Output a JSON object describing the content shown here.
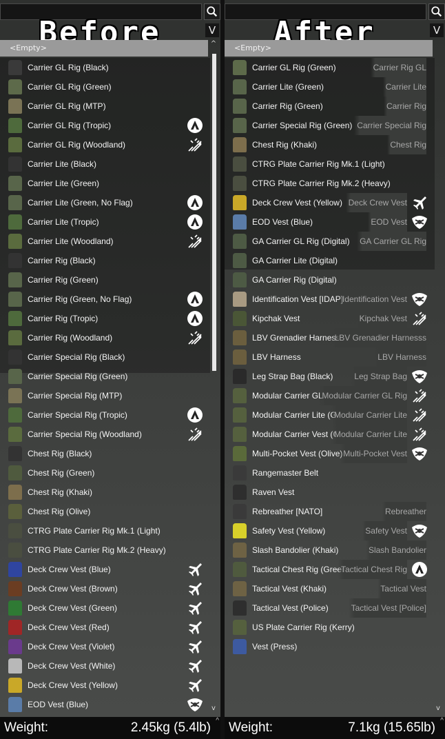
{
  "left": {
    "banner": "Before",
    "search": {
      "value": "",
      "placeholder": ""
    },
    "sort_label": "V",
    "empty_label": "<Empty>",
    "weight_label": "Weight:",
    "weight_value": "2.45kg (5.4lb)",
    "items": [
      {
        "name": "Carrier GL Rig (Black)",
        "source": "",
        "icon": "",
        "color": "#3a3a3a"
      },
      {
        "name": "Carrier GL Rig (Green)",
        "source": "",
        "icon": "",
        "color": "#5d6a4a"
      },
      {
        "name": "Carrier GL Rig (MTP)",
        "source": "",
        "icon": "",
        "color": "#7a7355"
      },
      {
        "name": "Carrier GL Rig (Tropic)",
        "source": "",
        "icon": "apex-icon",
        "color": "#4e6a3c"
      },
      {
        "name": "Carrier GL Rig (Woodland)",
        "source": "",
        "icon": "contact-icon",
        "color": "#5a6b3e"
      },
      {
        "name": "Carrier Lite (Black)",
        "source": "",
        "icon": "",
        "color": "#333"
      },
      {
        "name": "Carrier Lite (Green)",
        "source": "",
        "icon": "",
        "color": "#58654a"
      },
      {
        "name": "Carrier Lite (Green, No Flag)",
        "source": "",
        "icon": "apex-icon",
        "color": "#58654a"
      },
      {
        "name": "Carrier Lite (Tropic)",
        "source": "",
        "icon": "apex-icon",
        "color": "#4e6a3c"
      },
      {
        "name": "Carrier Lite (Woodland)",
        "source": "",
        "icon": "contact-icon",
        "color": "#5a6b3e"
      },
      {
        "name": "Carrier Rig (Black)",
        "source": "",
        "icon": "",
        "color": "#333"
      },
      {
        "name": "Carrier Rig (Green)",
        "source": "",
        "icon": "",
        "color": "#58654a"
      },
      {
        "name": "Carrier Rig (Green, No Flag)",
        "source": "",
        "icon": "apex-icon",
        "color": "#58654a"
      },
      {
        "name": "Carrier Rig (Tropic)",
        "source": "",
        "icon": "apex-icon",
        "color": "#4e6a3c"
      },
      {
        "name": "Carrier Rig (Woodland)",
        "source": "",
        "icon": "contact-icon",
        "color": "#5a6b3e"
      },
      {
        "name": "Carrier Special Rig (Black)",
        "source": "",
        "icon": "",
        "color": "#333"
      },
      {
        "name": "Carrier Special Rig (Green)",
        "source": "",
        "icon": "",
        "color": "#58654a"
      },
      {
        "name": "Carrier Special Rig (MTP)",
        "source": "",
        "icon": "",
        "color": "#7a7355"
      },
      {
        "name": "Carrier Special Rig (Tropic)",
        "source": "",
        "icon": "apex-icon",
        "color": "#4e6a3c"
      },
      {
        "name": "Carrier Special Rig (Woodland)",
        "source": "",
        "icon": "contact-icon",
        "color": "#5a6b3e"
      },
      {
        "name": "Chest Rig (Black)",
        "source": "",
        "icon": "",
        "color": "#333"
      },
      {
        "name": "Chest Rig (Green)",
        "source": "",
        "icon": "",
        "color": "#4f5a3e"
      },
      {
        "name": "Chest Rig (Khaki)",
        "source": "",
        "icon": "",
        "color": "#7d6e4c"
      },
      {
        "name": "Chest Rig (Olive)",
        "source": "",
        "icon": "",
        "color": "#5a5f3c"
      },
      {
        "name": "CTRG Plate Carrier Rig Mk.1 (Light)",
        "source": "",
        "icon": "",
        "color": "#4a4e40"
      },
      {
        "name": "CTRG Plate Carrier Rig Mk.2 (Heavy)",
        "source": "",
        "icon": "",
        "color": "#4a4e40"
      },
      {
        "name": "Deck Crew Vest (Blue)",
        "source": "",
        "icon": "jets-icon",
        "color": "#2f45a0"
      },
      {
        "name": "Deck Crew Vest (Brown)",
        "source": "",
        "icon": "jets-icon",
        "color": "#6b3d22"
      },
      {
        "name": "Deck Crew Vest (Green)",
        "source": "",
        "icon": "jets-icon",
        "color": "#2f7a34"
      },
      {
        "name": "Deck Crew Vest (Red)",
        "source": "",
        "icon": "jets-icon",
        "color": "#a02626"
      },
      {
        "name": "Deck Crew Vest (Violet)",
        "source": "",
        "icon": "jets-icon",
        "color": "#6a3a8c"
      },
      {
        "name": "Deck Crew Vest (White)",
        "source": "",
        "icon": "jets-icon",
        "color": "#b8b8b8"
      },
      {
        "name": "Deck Crew Vest (Yellow)",
        "source": "",
        "icon": "jets-icon",
        "color": "#c9a828"
      },
      {
        "name": "EOD Vest (Blue)",
        "source": "",
        "icon": "laws-of-war-icon",
        "color": "#5a7ca8"
      }
    ]
  },
  "right": {
    "banner": "After",
    "search": {
      "value": "",
      "placeholder": ""
    },
    "sort_label": "V",
    "empty_label": "<Empty>",
    "weight_label": "Weight:",
    "weight_value": "7.1kg (15.65lb)",
    "items": [
      {
        "name": "Carrier GL Rig (Green)",
        "source": "Carrier Rig GL",
        "icon": "",
        "color": "#5d6a4a"
      },
      {
        "name": "Carrier Lite (Green)",
        "source": "Carrier Lite",
        "icon": "",
        "color": "#58654a"
      },
      {
        "name": "Carrier Rig (Green)",
        "source": "Carrier Rig",
        "icon": "",
        "color": "#58654a"
      },
      {
        "name": "Carrier Special Rig (Green)",
        "source": "Carrier Special Rig",
        "icon": "",
        "color": "#58654a"
      },
      {
        "name": "Chest Rig (Khaki)",
        "source": "Chest Rig",
        "icon": "",
        "color": "#7d6e4c"
      },
      {
        "name": "CTRG Plate Carrier Rig Mk.1 (Light)",
        "source": "",
        "icon": "",
        "color": "#4a4e40"
      },
      {
        "name": "CTRG Plate Carrier Rig Mk.2 (Heavy)",
        "source": "",
        "icon": "",
        "color": "#4a4e40"
      },
      {
        "name": "Deck Crew Vest (Yellow)",
        "source": "Deck Crew Vest",
        "icon": "jets-icon",
        "color": "#c9a828"
      },
      {
        "name": "EOD Vest (Blue)",
        "source": "EOD Vest",
        "icon": "laws-of-war-icon",
        "color": "#5a7ca8"
      },
      {
        "name": "GA Carrier GL Rig (Digital)",
        "source": "GA Carrier GL Rig",
        "icon": "",
        "color": "#4d5a44"
      },
      {
        "name": "GA Carrier Lite (Digital)",
        "source": "",
        "icon": "",
        "color": "#4d5a44"
      },
      {
        "name": "GA Carrier Rig (Digital)",
        "source": "",
        "icon": "",
        "color": "#4d5a44"
      },
      {
        "name": "Identification Vest [IDAP]",
        "source": "Identification Vest",
        "icon": "laws-of-war-icon",
        "color": "#a89a82"
      },
      {
        "name": "Kipchak Vest",
        "source": "Kipchak Vest",
        "icon": "contact-icon",
        "color": "#4a5636"
      },
      {
        "name": "LBV Grenadier Harness",
        "source": "LBV Grenadier Harnesss",
        "icon": "",
        "color": "#6b5e3e"
      },
      {
        "name": "LBV Harness",
        "source": "LBV Harness",
        "icon": "",
        "color": "#6b5e3e"
      },
      {
        "name": "Leg Strap Bag (Black)",
        "source": "Leg Strap Bag",
        "icon": "laws-of-war-icon",
        "color": "#2a2a2a"
      },
      {
        "name": "Modular Carrier GL Rig",
        "source": "Modular Carrier GL Rig",
        "icon": "contact-icon",
        "color": "#55603e"
      },
      {
        "name": "Modular Carrier Lite (Geo",
        "source": "Modular Carrier Lite",
        "icon": "contact-icon",
        "color": "#55603e"
      },
      {
        "name": "Modular Carrier Vest (Geo",
        "source": "Modular Carrier Lite",
        "icon": "contact-icon",
        "color": "#55603e"
      },
      {
        "name": "Multi-Pocket Vest (Olive)",
        "source": "Multi-Pocket Vest",
        "icon": "laws-of-war-icon",
        "color": "#5a6a3a"
      },
      {
        "name": "Rangemaster Belt",
        "source": "",
        "icon": "",
        "color": "#3a3a3a"
      },
      {
        "name": "Raven Vest",
        "source": "",
        "icon": "",
        "color": "#2e2e2e"
      },
      {
        "name": "Rebreather [NATO]",
        "source": "Rebreather",
        "icon": "",
        "color": "#3a3a3a"
      },
      {
        "name": "Safety Vest (Yellow)",
        "source": "Safety Vest",
        "icon": "laws-of-war-icon",
        "color": "#d8d02a"
      },
      {
        "name": "Slash Bandolier (Khaki)",
        "source": "Slash Bandolier",
        "icon": "",
        "color": "#6e6244"
      },
      {
        "name": "Tactical Chest Rig (Green)",
        "source": "Tactical Chest Rig",
        "icon": "apex-icon",
        "color": "#4f5a3e"
      },
      {
        "name": "Tactical Vest (Khaki)",
        "source": "Tactical Vest",
        "icon": "",
        "color": "#6e6244"
      },
      {
        "name": "Tactical Vest (Police)",
        "source": "Tactical Vest [Police]",
        "icon": "",
        "color": "#2e2e2e"
      },
      {
        "name": "US Plate Carrier Rig (Kerry)",
        "source": "",
        "icon": "",
        "color": "#55603e"
      },
      {
        "name": "Vest (Press)",
        "source": "",
        "icon": "",
        "color": "#3d5aa0"
      }
    ]
  }
}
